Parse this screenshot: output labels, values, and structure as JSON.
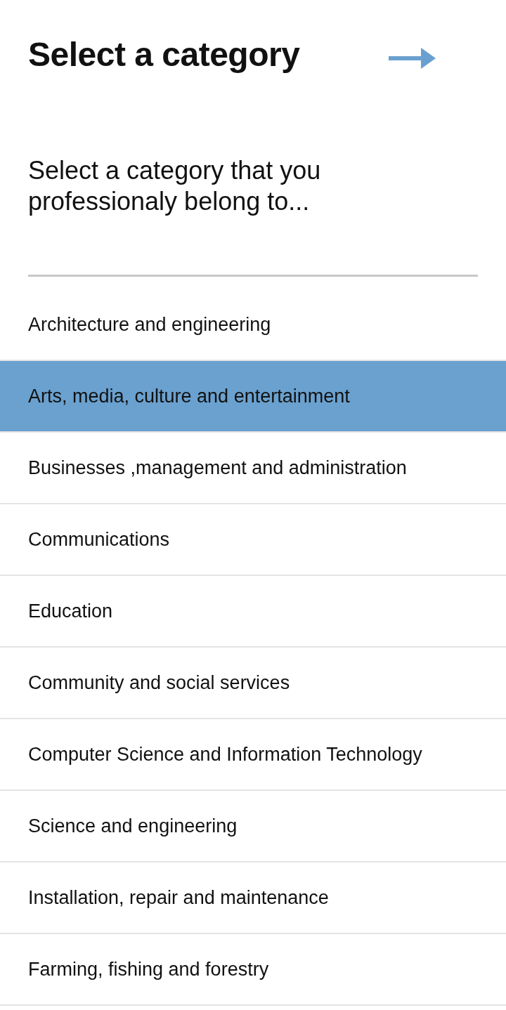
{
  "header": {
    "title": "Select a category"
  },
  "prompt": "Select a category that you professionaly belong to...",
  "categories": [
    {
      "label": "Architecture and engineering",
      "selected": false
    },
    {
      "label": "Arts, media, culture and entertainment",
      "selected": true
    },
    {
      "label": "Businesses ,management and administration",
      "selected": false
    },
    {
      "label": "Communications",
      "selected": false
    },
    {
      "label": "Education",
      "selected": false
    },
    {
      "label": "Community and social services",
      "selected": false
    },
    {
      "label": "Computer Science and Information Technology",
      "selected": false
    },
    {
      "label": "Science and engineering",
      "selected": false
    },
    {
      "label": "Installation, repair and maintenance",
      "selected": false
    },
    {
      "label": "Farming, fishing and forestry",
      "selected": false
    }
  ]
}
